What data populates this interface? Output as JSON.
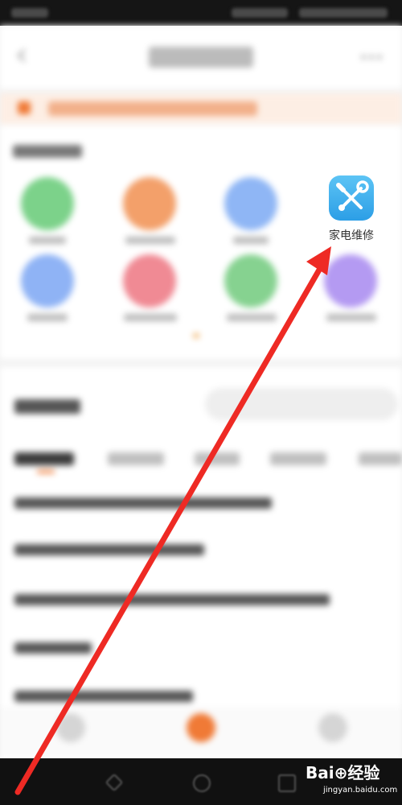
{
  "highlighted_app": {
    "label": "家电维修",
    "icon": "wrench-screwdriver-icon",
    "color": "#2c9ee6"
  },
  "watermark": {
    "logo": "Bai⊕经验",
    "sub": "jingyan.baidu.com"
  },
  "colors": {
    "accent": "#f07a36",
    "arrow": "#ee2a24"
  }
}
